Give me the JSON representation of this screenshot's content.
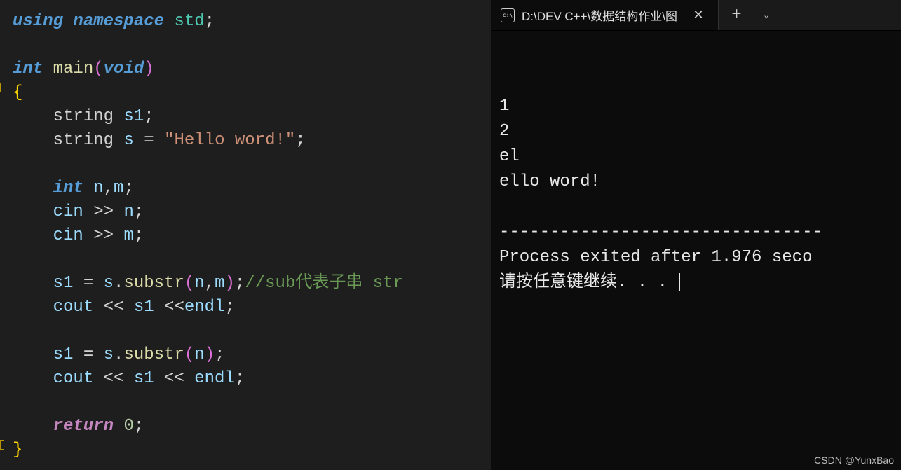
{
  "editor": {
    "lines": [
      [
        {
          "t": "using",
          "c": "kw"
        },
        {
          "t": " ",
          "c": "plain"
        },
        {
          "t": "namespace",
          "c": "kw"
        },
        {
          "t": " ",
          "c": "plain"
        },
        {
          "t": "std",
          "c": "ns"
        },
        {
          "t": ";",
          "c": "semi"
        }
      ],
      [],
      [
        {
          "t": "int",
          "c": "kw-type"
        },
        {
          "t": " ",
          "c": "plain"
        },
        {
          "t": "main",
          "c": "fn"
        },
        {
          "t": "(",
          "c": "paren"
        },
        {
          "t": "void",
          "c": "kw-type"
        },
        {
          "t": ")",
          "c": "paren"
        }
      ],
      [
        {
          "t": "{",
          "c": "brace-y"
        }
      ],
      [
        {
          "t": "    string ",
          "c": "plain"
        },
        {
          "t": "s1",
          "c": "ident"
        },
        {
          "t": ";",
          "c": "semi"
        }
      ],
      [
        {
          "t": "    string ",
          "c": "plain"
        },
        {
          "t": "s",
          "c": "ident"
        },
        {
          "t": " = ",
          "c": "plain"
        },
        {
          "t": "\"Hello word!\"",
          "c": "str"
        },
        {
          "t": ";",
          "c": "semi"
        }
      ],
      [],
      [
        {
          "t": "    ",
          "c": "plain"
        },
        {
          "t": "int",
          "c": "kw-type"
        },
        {
          "t": " ",
          "c": "plain"
        },
        {
          "t": "n",
          "c": "ident"
        },
        {
          "t": ",",
          "c": "plain"
        },
        {
          "t": "m",
          "c": "ident"
        },
        {
          "t": ";",
          "c": "semi"
        }
      ],
      [
        {
          "t": "    ",
          "c": "plain"
        },
        {
          "t": "cin",
          "c": "ident"
        },
        {
          "t": " >> ",
          "c": "plain"
        },
        {
          "t": "n",
          "c": "ident"
        },
        {
          "t": ";",
          "c": "semi"
        }
      ],
      [
        {
          "t": "    ",
          "c": "plain"
        },
        {
          "t": "cin",
          "c": "ident"
        },
        {
          "t": " >> ",
          "c": "plain"
        },
        {
          "t": "m",
          "c": "ident"
        },
        {
          "t": ";",
          "c": "semi"
        }
      ],
      [],
      [
        {
          "t": "    ",
          "c": "plain"
        },
        {
          "t": "s1",
          "c": "ident"
        },
        {
          "t": " = ",
          "c": "plain"
        },
        {
          "t": "s",
          "c": "ident"
        },
        {
          "t": ".",
          "c": "plain"
        },
        {
          "t": "substr",
          "c": "fn"
        },
        {
          "t": "(",
          "c": "paren"
        },
        {
          "t": "n",
          "c": "ident"
        },
        {
          "t": ",",
          "c": "plain"
        },
        {
          "t": "m",
          "c": "ident"
        },
        {
          "t": ")",
          "c": "paren"
        },
        {
          "t": ";",
          "c": "semi"
        },
        {
          "t": "//sub代表子串 str",
          "c": "comment"
        }
      ],
      [
        {
          "t": "    ",
          "c": "plain"
        },
        {
          "t": "cout",
          "c": "ident"
        },
        {
          "t": " << ",
          "c": "plain"
        },
        {
          "t": "s1",
          "c": "ident"
        },
        {
          "t": " <<",
          "c": "plain"
        },
        {
          "t": "endl",
          "c": "ident"
        },
        {
          "t": ";",
          "c": "semi"
        }
      ],
      [],
      [
        {
          "t": "    ",
          "c": "plain"
        },
        {
          "t": "s1",
          "c": "ident"
        },
        {
          "t": " = ",
          "c": "plain"
        },
        {
          "t": "s",
          "c": "ident"
        },
        {
          "t": ".",
          "c": "plain"
        },
        {
          "t": "substr",
          "c": "fn"
        },
        {
          "t": "(",
          "c": "paren"
        },
        {
          "t": "n",
          "c": "ident"
        },
        {
          "t": ")",
          "c": "paren"
        },
        {
          "t": ";",
          "c": "semi"
        }
      ],
      [
        {
          "t": "    ",
          "c": "plain"
        },
        {
          "t": "cout",
          "c": "ident"
        },
        {
          "t": " << ",
          "c": "plain"
        },
        {
          "t": "s1",
          "c": "ident"
        },
        {
          "t": " << ",
          "c": "plain"
        },
        {
          "t": "endl",
          "c": "ident"
        },
        {
          "t": ";",
          "c": "semi"
        }
      ],
      [],
      [
        {
          "t": "    ",
          "c": "plain"
        },
        {
          "t": "return",
          "c": "kw-ret"
        },
        {
          "t": " ",
          "c": "plain"
        },
        {
          "t": "0",
          "c": "num"
        },
        {
          "t": ";",
          "c": "semi"
        }
      ],
      [
        {
          "t": "}",
          "c": "brace-y"
        }
      ]
    ]
  },
  "terminal": {
    "tab_icon_text": "c:\\",
    "tab_title": "D:\\DEV C++\\数据结构作业\\图",
    "close_glyph": "✕",
    "plus_glyph": "+",
    "dropdown_glyph": "⌄",
    "output_lines": [
      "1",
      "2",
      "el",
      "ello word!",
      "",
      "--------------------------------",
      "Process exited after 1.976 seco",
      "请按任意键继续. . . "
    ]
  },
  "watermark": "CSDN @YunxBao"
}
